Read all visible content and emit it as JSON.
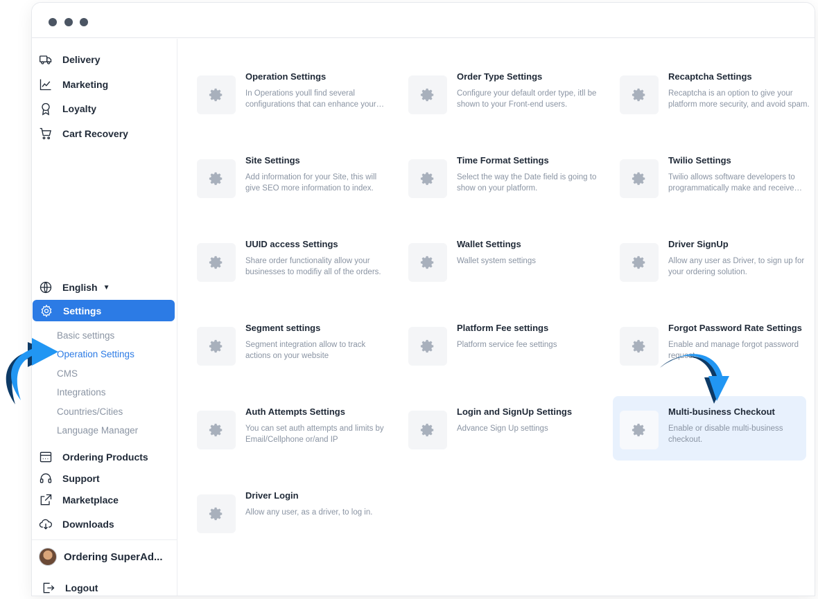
{
  "sidebar": {
    "top_items": [
      {
        "label": "Delivery",
        "icon": "truck-icon"
      },
      {
        "label": "Marketing",
        "icon": "chart-line-icon"
      },
      {
        "label": "Loyalty",
        "icon": "award-icon"
      },
      {
        "label": "Cart Recovery",
        "icon": "cart-icon"
      }
    ],
    "language": {
      "label": "English",
      "icon": "globe-icon"
    },
    "settings": {
      "label": "Settings",
      "icon": "gear-icon"
    },
    "sub_items": [
      {
        "label": "Basic settings"
      },
      {
        "label": "Operation Settings"
      },
      {
        "label": "CMS"
      },
      {
        "label": "Integrations"
      },
      {
        "label": "Countries/Cities"
      },
      {
        "label": "Language Manager"
      }
    ],
    "bottom_items": [
      {
        "label": "Ordering Products",
        "icon": "browser-icon"
      },
      {
        "label": "Support",
        "icon": "headset-icon"
      },
      {
        "label": "Marketplace",
        "icon": "external-link-icon"
      },
      {
        "label": "Downloads",
        "icon": "cloud-download-icon"
      }
    ],
    "user": {
      "name": "Ordering SuperAd..."
    },
    "logout": {
      "label": "Logout",
      "icon": "logout-icon"
    }
  },
  "cards": [
    {
      "title": "Operation Settings",
      "desc": "In Operations youll find several configurations that can enhance your business."
    },
    {
      "title": "Order Type Settings",
      "desc": "Configure your default order type, itll be shown to your Front-end users."
    },
    {
      "title": "Recaptcha Settings",
      "desc": "Recaptcha is an option to give your platform more security, and avoid spam."
    },
    {
      "title": "Site Settings",
      "desc": "Add information for your Site, this will give SEO more information to index."
    },
    {
      "title": "Time Format Settings",
      "desc": "Select the way the Date field is going to show on your platform."
    },
    {
      "title": "Twilio Settings",
      "desc": "Twilio allows software developers to programmatically make and receive calls."
    },
    {
      "title": "UUID access Settings",
      "desc": "Share order functionality allow your businesses to modifiy all of the orders."
    },
    {
      "title": "Wallet Settings",
      "desc": "Wallet system settings"
    },
    {
      "title": "Driver SignUp",
      "desc": "Allow any user as Driver, to sign up for your ordering solution."
    },
    {
      "title": "Segment settings",
      "desc": "Segment integration allow to track actions on your website"
    },
    {
      "title": "Platform Fee settings",
      "desc": "Platform service fee settings"
    },
    {
      "title": "Forgot Password Rate Settings",
      "desc": "Enable and manage forgot password request"
    },
    {
      "title": "Auth Attempts Settings",
      "desc": "You can set auth attempts and limits by Email/Cellphone or/and IP"
    },
    {
      "title": "Login and SignUp Settings",
      "desc": "Advance Sign Up settings"
    },
    {
      "title": "Multi-business Checkout",
      "desc": "Enable or disable multi-business checkout."
    },
    {
      "title": "Driver Login",
      "desc": "Allow any user, as a driver, to log in."
    }
  ],
  "colors": {
    "accent": "#2c7be5",
    "arrow": "#2196f3",
    "arrow_shadow": "#0d3a66"
  }
}
